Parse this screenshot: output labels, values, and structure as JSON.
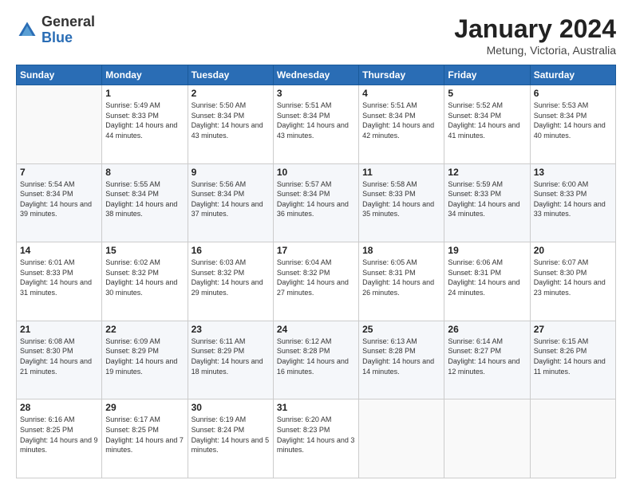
{
  "header": {
    "logo": {
      "general": "General",
      "blue": "Blue"
    },
    "title": "January 2024",
    "location": "Metung, Victoria, Australia"
  },
  "weekdays": [
    "Sunday",
    "Monday",
    "Tuesday",
    "Wednesday",
    "Thursday",
    "Friday",
    "Saturday"
  ],
  "weeks": [
    [
      {
        "day": null
      },
      {
        "day": 1,
        "sunrise": "5:49 AM",
        "sunset": "8:33 PM",
        "daylight": "14 hours and 44 minutes."
      },
      {
        "day": 2,
        "sunrise": "5:50 AM",
        "sunset": "8:34 PM",
        "daylight": "14 hours and 43 minutes."
      },
      {
        "day": 3,
        "sunrise": "5:51 AM",
        "sunset": "8:34 PM",
        "daylight": "14 hours and 43 minutes."
      },
      {
        "day": 4,
        "sunrise": "5:51 AM",
        "sunset": "8:34 PM",
        "daylight": "14 hours and 42 minutes."
      },
      {
        "day": 5,
        "sunrise": "5:52 AM",
        "sunset": "8:34 PM",
        "daylight": "14 hours and 41 minutes."
      },
      {
        "day": 6,
        "sunrise": "5:53 AM",
        "sunset": "8:34 PM",
        "daylight": "14 hours and 40 minutes."
      }
    ],
    [
      {
        "day": 7,
        "sunrise": "5:54 AM",
        "sunset": "8:34 PM",
        "daylight": "14 hours and 39 minutes."
      },
      {
        "day": 8,
        "sunrise": "5:55 AM",
        "sunset": "8:34 PM",
        "daylight": "14 hours and 38 minutes."
      },
      {
        "day": 9,
        "sunrise": "5:56 AM",
        "sunset": "8:34 PM",
        "daylight": "14 hours and 37 minutes."
      },
      {
        "day": 10,
        "sunrise": "5:57 AM",
        "sunset": "8:34 PM",
        "daylight": "14 hours and 36 minutes."
      },
      {
        "day": 11,
        "sunrise": "5:58 AM",
        "sunset": "8:33 PM",
        "daylight": "14 hours and 35 minutes."
      },
      {
        "day": 12,
        "sunrise": "5:59 AM",
        "sunset": "8:33 PM",
        "daylight": "14 hours and 34 minutes."
      },
      {
        "day": 13,
        "sunrise": "6:00 AM",
        "sunset": "8:33 PM",
        "daylight": "14 hours and 33 minutes."
      }
    ],
    [
      {
        "day": 14,
        "sunrise": "6:01 AM",
        "sunset": "8:33 PM",
        "daylight": "14 hours and 31 minutes."
      },
      {
        "day": 15,
        "sunrise": "6:02 AM",
        "sunset": "8:32 PM",
        "daylight": "14 hours and 30 minutes."
      },
      {
        "day": 16,
        "sunrise": "6:03 AM",
        "sunset": "8:32 PM",
        "daylight": "14 hours and 29 minutes."
      },
      {
        "day": 17,
        "sunrise": "6:04 AM",
        "sunset": "8:32 PM",
        "daylight": "14 hours and 27 minutes."
      },
      {
        "day": 18,
        "sunrise": "6:05 AM",
        "sunset": "8:31 PM",
        "daylight": "14 hours and 26 minutes."
      },
      {
        "day": 19,
        "sunrise": "6:06 AM",
        "sunset": "8:31 PM",
        "daylight": "14 hours and 24 minutes."
      },
      {
        "day": 20,
        "sunrise": "6:07 AM",
        "sunset": "8:30 PM",
        "daylight": "14 hours and 23 minutes."
      }
    ],
    [
      {
        "day": 21,
        "sunrise": "6:08 AM",
        "sunset": "8:30 PM",
        "daylight": "14 hours and 21 minutes."
      },
      {
        "day": 22,
        "sunrise": "6:09 AM",
        "sunset": "8:29 PM",
        "daylight": "14 hours and 19 minutes."
      },
      {
        "day": 23,
        "sunrise": "6:11 AM",
        "sunset": "8:29 PM",
        "daylight": "14 hours and 18 minutes."
      },
      {
        "day": 24,
        "sunrise": "6:12 AM",
        "sunset": "8:28 PM",
        "daylight": "14 hours and 16 minutes."
      },
      {
        "day": 25,
        "sunrise": "6:13 AM",
        "sunset": "8:28 PM",
        "daylight": "14 hours and 14 minutes."
      },
      {
        "day": 26,
        "sunrise": "6:14 AM",
        "sunset": "8:27 PM",
        "daylight": "14 hours and 12 minutes."
      },
      {
        "day": 27,
        "sunrise": "6:15 AM",
        "sunset": "8:26 PM",
        "daylight": "14 hours and 11 minutes."
      }
    ],
    [
      {
        "day": 28,
        "sunrise": "6:16 AM",
        "sunset": "8:25 PM",
        "daylight": "14 hours and 9 minutes."
      },
      {
        "day": 29,
        "sunrise": "6:17 AM",
        "sunset": "8:25 PM",
        "daylight": "14 hours and 7 minutes."
      },
      {
        "day": 30,
        "sunrise": "6:19 AM",
        "sunset": "8:24 PM",
        "daylight": "14 hours and 5 minutes."
      },
      {
        "day": 31,
        "sunrise": "6:20 AM",
        "sunset": "8:23 PM",
        "daylight": "14 hours and 3 minutes."
      },
      {
        "day": null
      },
      {
        "day": null
      },
      {
        "day": null
      }
    ]
  ]
}
